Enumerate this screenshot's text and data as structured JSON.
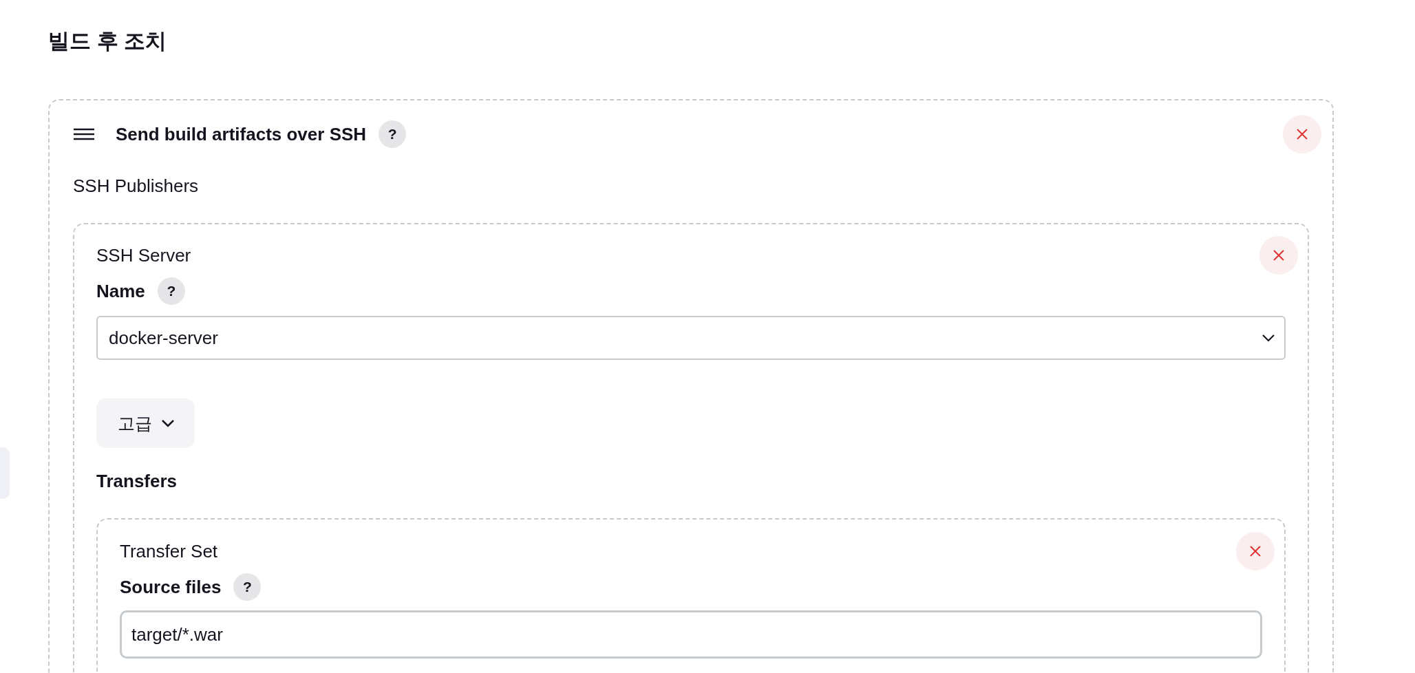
{
  "heading": "빌드 후 조치",
  "step": {
    "title": "Send build artifacts over SSH",
    "help": "?",
    "section_label": "SSH Publishers",
    "publisher": {
      "title": "SSH Server",
      "name_label": "Name",
      "help": "?",
      "name_value": "docker-server",
      "advanced_button": "고급",
      "transfers_label": "Transfers",
      "transfer_set": {
        "title": "Transfer Set",
        "source_label": "Source files",
        "help": "?",
        "source_value": "target/*.war"
      }
    }
  }
}
